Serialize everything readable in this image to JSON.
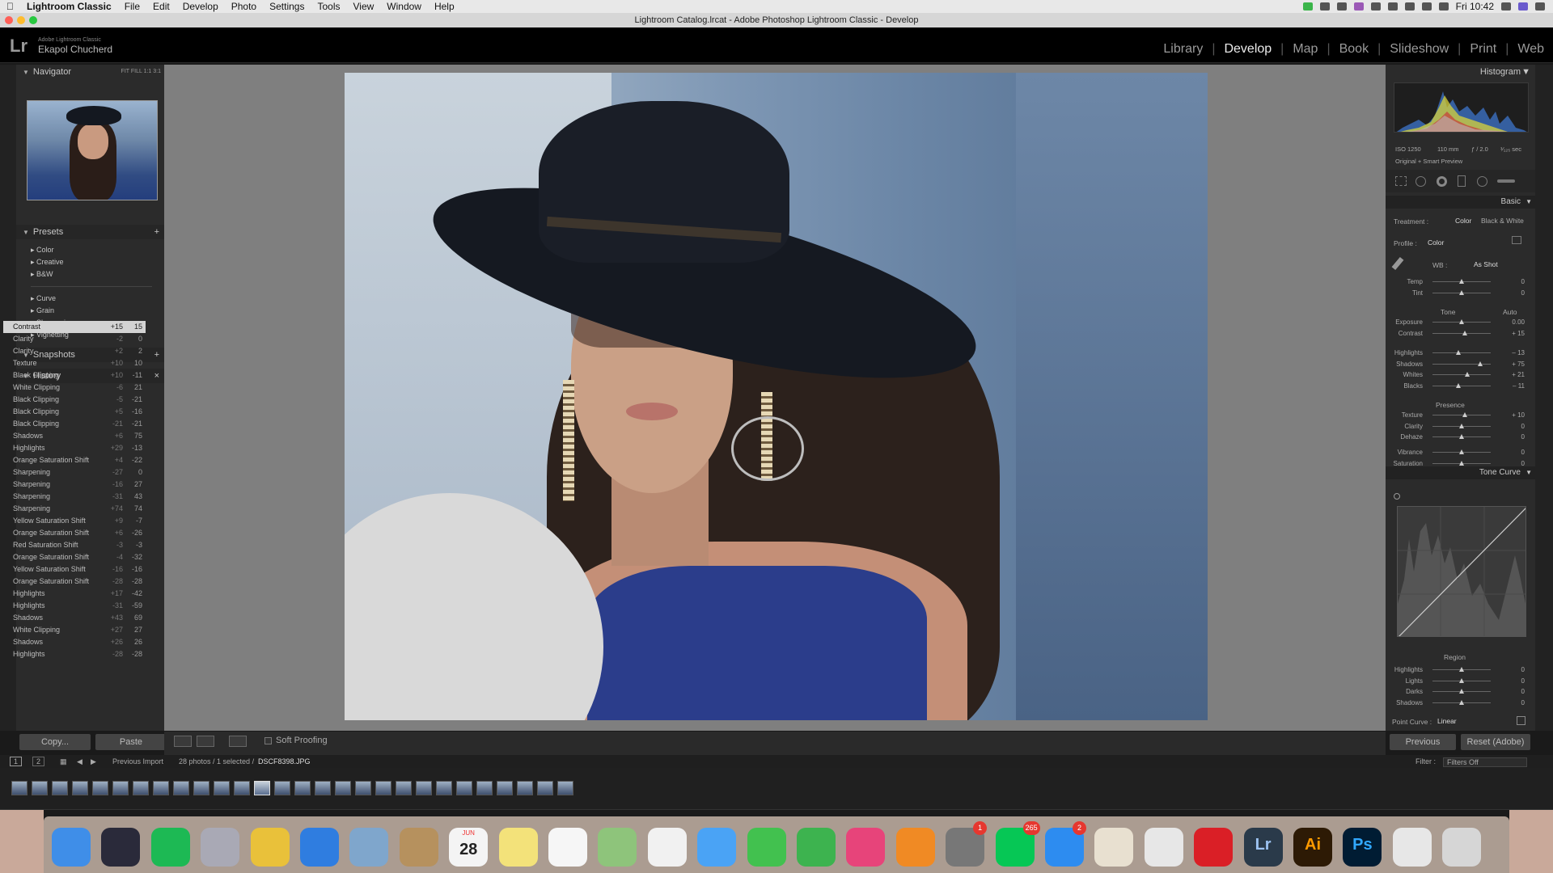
{
  "menubar": {
    "app": "Lightroom Classic",
    "items": [
      "File",
      "Edit",
      "Develop",
      "Photo",
      "Settings",
      "Tools",
      "View",
      "Window",
      "Help"
    ],
    "clock": "Fri 10:42"
  },
  "window": {
    "title": "Lightroom Catalog.lrcat - Adobe Photoshop Lightroom Classic - Develop"
  },
  "identity": {
    "logo": "Lr",
    "product": "Adobe Lightroom Classic",
    "user": "Ekapol Chucherd"
  },
  "modules": [
    "Library",
    "Develop",
    "Map",
    "Book",
    "Slideshow",
    "Print",
    "Web"
  ],
  "active_module": "Develop",
  "left": {
    "navigator": {
      "title": "Navigator",
      "zoom": [
        "FIT",
        "FILL",
        "1:1",
        "3:1"
      ]
    },
    "presets": {
      "title": "Presets",
      "groups1": [
        "Color",
        "Creative",
        "B&W"
      ],
      "groups2": [
        "Curve",
        "Grain",
        "Sharpening",
        "Vignetting"
      ]
    },
    "snapshots": {
      "title": "Snapshots"
    },
    "history": {
      "title": "History",
      "close": "×",
      "items": [
        {
          "name": "Contrast",
          "delta": "+15",
          "value": "15"
        },
        {
          "name": "Clarity",
          "delta": "-2",
          "value": "0"
        },
        {
          "name": "Clarity",
          "delta": "+2",
          "value": "2"
        },
        {
          "name": "Texture",
          "delta": "+10",
          "value": "10"
        },
        {
          "name": "Black Clipping",
          "delta": "+10",
          "value": "-11"
        },
        {
          "name": "White Clipping",
          "delta": "-6",
          "value": "21"
        },
        {
          "name": "Black Clipping",
          "delta": "-5",
          "value": "-21"
        },
        {
          "name": "Black Clipping",
          "delta": "+5",
          "value": "-16"
        },
        {
          "name": "Black Clipping",
          "delta": "-21",
          "value": "-21"
        },
        {
          "name": "Shadows",
          "delta": "+6",
          "value": "75"
        },
        {
          "name": "Highlights",
          "delta": "+29",
          "value": "-13"
        },
        {
          "name": "Orange Saturation Shift",
          "delta": "+4",
          "value": "-22"
        },
        {
          "name": "Sharpening",
          "delta": "-27",
          "value": "0"
        },
        {
          "name": "Sharpening",
          "delta": "-16",
          "value": "27"
        },
        {
          "name": "Sharpening",
          "delta": "-31",
          "value": "43"
        },
        {
          "name": "Sharpening",
          "delta": "+74",
          "value": "74"
        },
        {
          "name": "Yellow Saturation Shift",
          "delta": "+9",
          "value": "-7"
        },
        {
          "name": "Orange Saturation Shift",
          "delta": "+6",
          "value": "-26"
        },
        {
          "name": "Red Saturation Shift",
          "delta": "-3",
          "value": "-3"
        },
        {
          "name": "Orange Saturation Shift",
          "delta": "-4",
          "value": "-32"
        },
        {
          "name": "Yellow Saturation Shift",
          "delta": "-16",
          "value": "-16"
        },
        {
          "name": "Orange Saturation Shift",
          "delta": "-28",
          "value": "-28"
        },
        {
          "name": "Highlights",
          "delta": "+17",
          "value": "-42"
        },
        {
          "name": "Highlights",
          "delta": "-31",
          "value": "-59"
        },
        {
          "name": "Shadows",
          "delta": "+43",
          "value": "69"
        },
        {
          "name": "White Clipping",
          "delta": "+27",
          "value": "27"
        },
        {
          "name": "Shadows",
          "delta": "+26",
          "value": "26"
        },
        {
          "name": "Highlights",
          "delta": "-28",
          "value": "-28"
        }
      ]
    },
    "buttons": {
      "copy": "Copy...",
      "paste": "Paste"
    }
  },
  "toolbar": {
    "soft_proofing": "Soft Proofing"
  },
  "filmstrip": {
    "page1": "1",
    "page2": "2",
    "source": "Previous Import",
    "count": "28 photos / 1 selected /",
    "file": "DSCF8398.JPG",
    "filter_label": "Filter :",
    "filter_value": "Filters Off"
  },
  "right": {
    "histogram": {
      "title": "Histogram",
      "iso": "ISO 1250",
      "focal": "110 mm",
      "aperture": "ƒ / 2.0",
      "shutter": "¹⁄₁₂₅ sec",
      "preview": "Original + Smart Preview"
    },
    "basic": {
      "title": "Basic",
      "treatment_label": "Treatment :",
      "treatment_color": "Color",
      "treatment_bw": "Black & White",
      "profile_label": "Profile :",
      "profile_value": "Color",
      "wb_label": "WB :",
      "wb_value": "As Shot",
      "temp": {
        "label": "Temp",
        "value": "0",
        "level": 0.5
      },
      "tint": {
        "label": "Tint",
        "value": "0",
        "level": 0.5
      },
      "tone_label": "Tone",
      "auto": "Auto",
      "tone": [
        {
          "label": "Exposure",
          "value": "0.00",
          "level": 0.5
        },
        {
          "label": "Contrast",
          "value": "+ 15",
          "level": 0.55
        }
      ],
      "tone2": [
        {
          "label": "Highlights",
          "value": "– 13",
          "level": 0.44
        },
        {
          "label": "Shadows",
          "value": "+ 75",
          "level": 0.82
        },
        {
          "label": "Whites",
          "value": "+ 21",
          "level": 0.6
        },
        {
          "label": "Blacks",
          "value": "– 11",
          "level": 0.45
        }
      ],
      "presence_label": "Presence",
      "presence": [
        {
          "label": "Texture",
          "value": "+ 10",
          "level": 0.55
        },
        {
          "label": "Clarity",
          "value": "0",
          "level": 0.5
        },
        {
          "label": "Dehaze",
          "value": "0",
          "level": 0.5
        }
      ],
      "color": [
        {
          "label": "Vibrance",
          "value": "0",
          "level": 0.5
        },
        {
          "label": "Saturation",
          "value": "0",
          "level": 0.5
        }
      ]
    },
    "tonecurve": {
      "title": "Tone Curve",
      "region_label": "Region",
      "region": [
        {
          "label": "Highlights",
          "value": "0",
          "level": 0.5
        },
        {
          "label": "Lights",
          "value": "0",
          "level": 0.5
        },
        {
          "label": "Darks",
          "value": "0",
          "level": 0.5
        },
        {
          "label": "Shadows",
          "value": "0",
          "level": 0.5
        }
      ],
      "point_curve_label": "Point Curve :",
      "point_curve_value": "Linear"
    },
    "buttons": {
      "previous": "Previous",
      "reset": "Reset (Adobe)"
    }
  },
  "dock": {
    "apps": [
      {
        "name": "finder",
        "color": "#3f8ee8"
      },
      {
        "name": "siri",
        "color": "#2a2a3a"
      },
      {
        "name": "spotify",
        "color": "#1db954"
      },
      {
        "name": "launchpad",
        "color": "#a9a9b5"
      },
      {
        "name": "chrome",
        "color": "#e9c13a"
      },
      {
        "name": "safari",
        "color": "#2f7de0"
      },
      {
        "name": "mail",
        "color": "#7fa6cc"
      },
      {
        "name": "contacts",
        "color": "#b6915e"
      },
      {
        "name": "calendar",
        "color": "#f4f4f4",
        "label": "28",
        "month": "JUN"
      },
      {
        "name": "notes",
        "color": "#f3e27a"
      },
      {
        "name": "reminders",
        "color": "#f6f6f6"
      },
      {
        "name": "maps",
        "color": "#8ec47b"
      },
      {
        "name": "photos",
        "color": "#f1f1f1"
      },
      {
        "name": "messages",
        "color": "#4aa3f5"
      },
      {
        "name": "facetime",
        "color": "#42c14f"
      },
      {
        "name": "numbers",
        "color": "#3db34f"
      },
      {
        "name": "itunes",
        "color": "#e7447a"
      },
      {
        "name": "books",
        "color": "#f08a24"
      },
      {
        "name": "system-preferences",
        "color": "#777",
        "badge": "1"
      },
      {
        "name": "line",
        "color": "#06c755",
        "badge": "265"
      },
      {
        "name": "app-store",
        "color": "#2d8cf0",
        "badge": "2"
      },
      {
        "name": "textedit",
        "color": "#e8e0d0"
      },
      {
        "name": "keynote",
        "color": "#e7e7e7"
      },
      {
        "name": "creative-cloud",
        "color": "#da1f26"
      },
      {
        "name": "lightroom",
        "color": "#2a3a4a",
        "label": "Lr",
        "label_color": "#9dc3f2"
      },
      {
        "name": "illustrator",
        "color": "#2d1a05",
        "label": "Ai",
        "label_color": "#ff9a00"
      },
      {
        "name": "photoshop",
        "color": "#001c33",
        "label": "Ps",
        "label_color": "#31a8ff"
      },
      {
        "name": "keyboard-viewer",
        "color": "#e7e7e7"
      },
      {
        "name": "trash",
        "color": "#d6d6d6"
      }
    ]
  }
}
